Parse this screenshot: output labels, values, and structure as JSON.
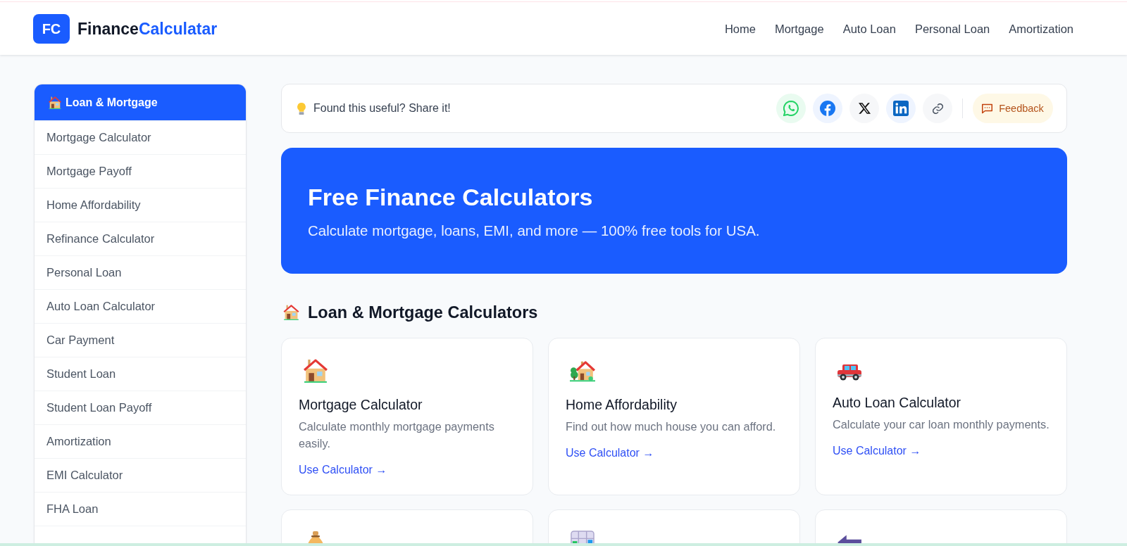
{
  "header": {
    "logo_badge": "FC",
    "brand": {
      "primary": "Finance",
      "accent": "Calculatar"
    },
    "nav": [
      "Home",
      "Mortgage",
      "Auto Loan",
      "Personal Loan",
      "Amortization"
    ]
  },
  "sidebar": {
    "title": "Loan & Mortgage",
    "items": [
      "Mortgage Calculator",
      "Mortgage Payoff",
      "Home Affordability",
      "Refinance Calculator",
      "Personal Loan",
      "Auto Loan Calculator",
      "Car Payment",
      "Student Loan",
      "Student Loan Payoff",
      "Amortization",
      "EMI Calculator",
      "FHA Loan"
    ]
  },
  "share_bar": {
    "prompt": "Found this useful? Share it!",
    "feedback": "Feedback"
  },
  "hero": {
    "title": "Free Finance Calculators",
    "subtitle": "Calculate mortgage, loans, EMI, and more — 100% free tools for USA."
  },
  "section": {
    "title": "Loan & Mortgage Calculators",
    "cards": [
      {
        "kind": "house",
        "title": "Mortgage Calculator",
        "description": "Calculate monthly mortgage payments easily.",
        "link": "Use Calculator →"
      },
      {
        "kind": "house-tree",
        "title": "Home Affordability",
        "description": "Find out how much house you can afford.",
        "link": "Use Calculator →"
      },
      {
        "kind": "car",
        "title": "Auto Loan Calculator",
        "description": "Calculate your car loan monthly payments.",
        "link": "Use Calculator →"
      },
      {
        "kind": "money-bag"
      },
      {
        "kind": "grid"
      },
      {
        "kind": "arrow"
      }
    ]
  }
}
